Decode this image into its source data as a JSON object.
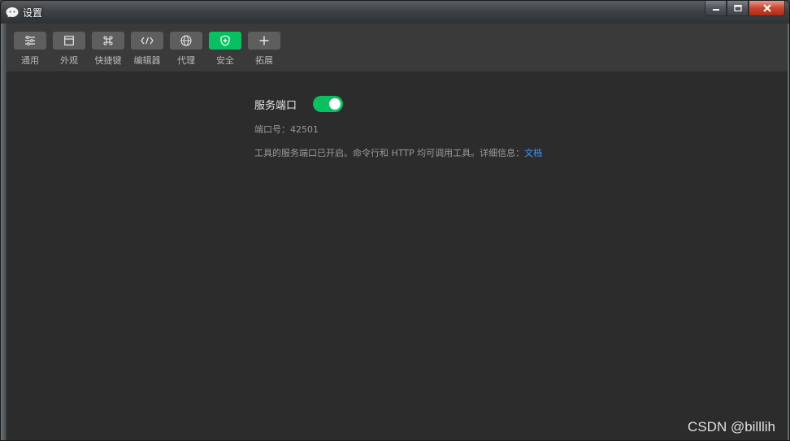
{
  "window": {
    "title": "设置"
  },
  "toolbar": {
    "items": [
      {
        "label": "通用",
        "icon": "sliders-icon"
      },
      {
        "label": "外观",
        "icon": "window-layout-icon"
      },
      {
        "label": "快捷键",
        "icon": "command-key-icon"
      },
      {
        "label": "编辑器",
        "icon": "code-brackets-icon"
      },
      {
        "label": "代理",
        "icon": "globe-icon"
      },
      {
        "label": "安全",
        "icon": "shield-icon",
        "active": true
      },
      {
        "label": "拓展",
        "icon": "plus-icon"
      }
    ]
  },
  "security": {
    "service_port_title": "服务端口",
    "service_port_enabled": true,
    "port_label": "端口号：",
    "port_value": "42501",
    "description": "工具的服务端口已开启。命令行和 HTTP 均可调用工具。详细信息：",
    "doc_link": "文档"
  },
  "watermark": "CSDN @billlih",
  "colors": {
    "accent_green": "#07c160",
    "link_blue": "#3a9dff",
    "background": "#2c2c2c",
    "toolbar": "#3a3a3a"
  }
}
